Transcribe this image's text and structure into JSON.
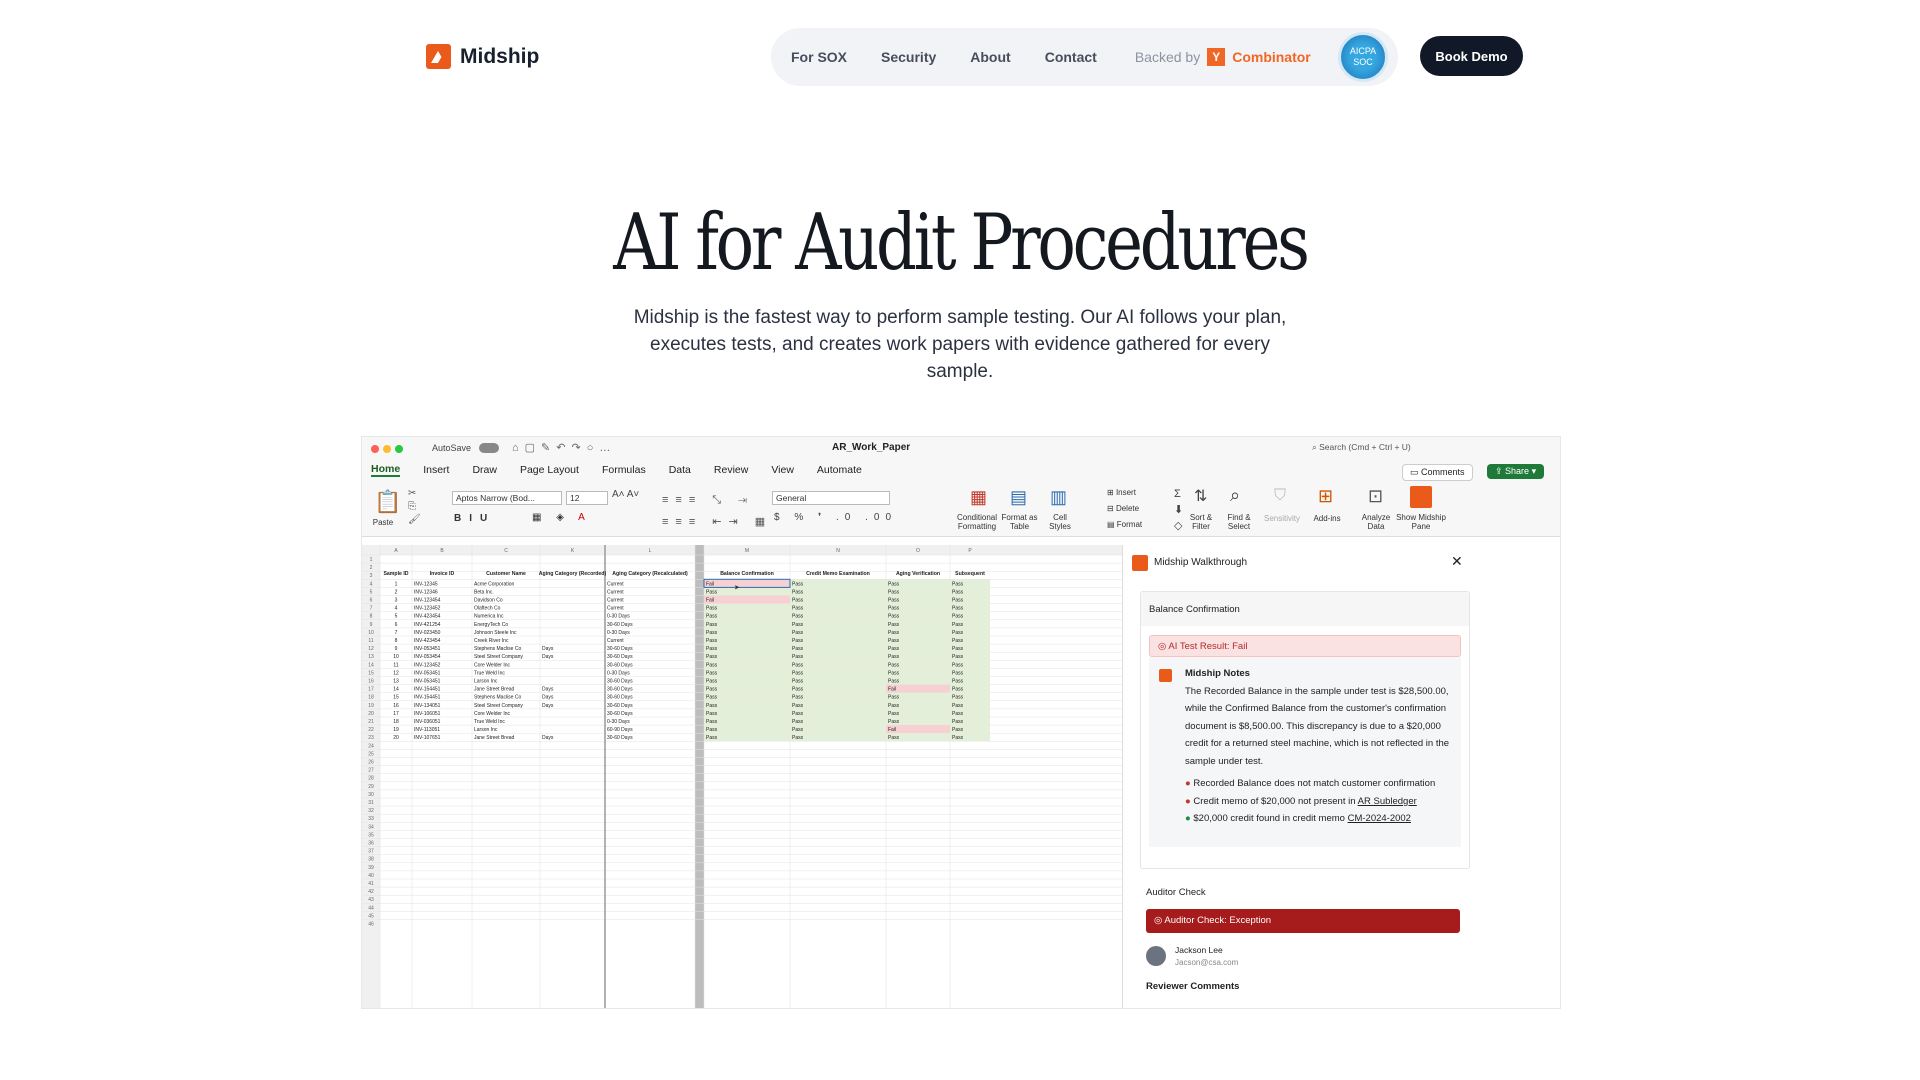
{
  "brand": {
    "name": "Midship"
  },
  "nav": {
    "items": [
      "For SOX",
      "Security",
      "About",
      "Contact"
    ],
    "backed_by": "Backed by",
    "yc_letter": "Y",
    "yc_name": "Combinator",
    "aicpa_line1": "AICPA",
    "aicpa_line2": "SOC",
    "cta": "Book Demo"
  },
  "hero": {
    "title": "AI for Audit Procedures",
    "subtitle_line1": "Midship is the fastest way to perform sample testing. Our AI follows your plan,",
    "subtitle_line2": "executes tests, and creates work papers with evidence gathered for every sample."
  },
  "excel": {
    "autosave": "AutoSave",
    "file_title": "AR_Work_Paper",
    "search_placeholder": "Search (Cmd + Ctrl + U)",
    "tabs": [
      "Home",
      "Insert",
      "Draw",
      "Page Layout",
      "Formulas",
      "Data",
      "Review",
      "View",
      "Automate"
    ],
    "comments": "Comments",
    "share": "Share",
    "font": "Aptos Narrow (Bod...",
    "font_size": "12",
    "number_format": "General",
    "ribbon_labels": {
      "paste": "Paste",
      "cond_format": "Conditional Formatting",
      "format_table": "Format as Table",
      "cell_styles": "Cell Styles",
      "insert": "Insert",
      "delete": "Delete",
      "format": "Format",
      "sort_filter": "Sort & Filter",
      "find_select": "Find & Select",
      "sensitivity": "Sensitivity",
      "addins": "Add-ins",
      "analyze": "Analyze Data",
      "show_midship": "Show Midship Pane"
    },
    "col_letters": [
      "A",
      "B",
      "C",
      "K",
      "L",
      "M",
      "N",
      "O",
      "P"
    ],
    "headers": [
      "Sample ID",
      "Invoice ID",
      "Customer Name",
      "Aging Category (Recorded)",
      "Aging Category (Recalculated)",
      "Balance Confirmation",
      "Credit Memo Examination",
      "Aging Verification",
      "Subsequent"
    ],
    "rows": [
      [
        "1",
        "INV-12345",
        "Acme Corporation",
        "",
        "Current",
        "Fail",
        "Pass",
        "Pass",
        "Pass"
      ],
      [
        "2",
        "INV-12346",
        "Beta Inc.",
        "",
        "Current",
        "Pass",
        "Pass",
        "Pass",
        "Pass"
      ],
      [
        "3",
        "INV-123454",
        "Davidson Co",
        "",
        "Current",
        "Fail",
        "Pass",
        "Pass",
        "Pass"
      ],
      [
        "4",
        "INV-123452",
        "Olaftech Co",
        "",
        "Current",
        "Pass",
        "Pass",
        "Pass",
        "Pass"
      ],
      [
        "5",
        "INV-423454",
        "Numerica Inc",
        "",
        "0-30 Days",
        "Pass",
        "Pass",
        "Pass",
        "Pass"
      ],
      [
        "6",
        "INV-421254",
        "EnergyTech Co",
        "",
        "30-60 Days",
        "Pass",
        "Pass",
        "Pass",
        "Pass"
      ],
      [
        "7",
        "INV-023450",
        "Johnson Steele Inc",
        "",
        "0-30 Days",
        "Pass",
        "Pass",
        "Pass",
        "Pass"
      ],
      [
        "8",
        "INV-423454",
        "Creek River Inc",
        "",
        "Current",
        "Pass",
        "Pass",
        "Pass",
        "Pass"
      ],
      [
        "9",
        "INV-053451",
        "Stephens Maclise Co",
        "Days",
        "30-60 Days",
        "Pass",
        "Pass",
        "Pass",
        "Pass"
      ],
      [
        "10",
        "INV-053454",
        "Steel Street Company",
        "Days",
        "30-60 Days",
        "Pass",
        "Pass",
        "Pass",
        "Pass"
      ],
      [
        "11",
        "INV-123452",
        "Core Welder Inc",
        "",
        "30-60 Days",
        "Pass",
        "Pass",
        "Pass",
        "Pass"
      ],
      [
        "12",
        "INV-053451",
        "True Weld Inc",
        "",
        "0-30 Days",
        "Pass",
        "Pass",
        "Pass",
        "Pass"
      ],
      [
        "13",
        "INV-053451",
        "Larson Inc",
        "",
        "30-60 Days",
        "Pass",
        "Pass",
        "Pass",
        "Pass"
      ],
      [
        "14",
        "INV-154451",
        "Jane Street Bread",
        "Days",
        "30-60 Days",
        "Pass",
        "Pass",
        "Fail",
        "Pass"
      ],
      [
        "15",
        "INV-154451",
        "Stephens Maclise Co",
        "Days",
        "30-60 Days",
        "Pass",
        "Pass",
        "Pass",
        "Pass"
      ],
      [
        "16",
        "INV-134051",
        "Steel Street Company",
        "Days",
        "30-60 Days",
        "Pass",
        "Pass",
        "Pass",
        "Pass"
      ],
      [
        "17",
        "INV-106051",
        "Core Welder Inc",
        "",
        "30-60 Days",
        "Pass",
        "Pass",
        "Pass",
        "Pass"
      ],
      [
        "18",
        "INV-036051",
        "True Weld Inc",
        "",
        "0-30 Days",
        "Pass",
        "Pass",
        "Pass",
        "Pass"
      ],
      [
        "19",
        "INV-113051",
        "Larson Inc",
        "",
        "60-90 Days",
        "Pass",
        "Pass",
        "Fail",
        "Pass"
      ],
      [
        "20",
        "INV-107651",
        "Jane Street Bread",
        "Days",
        "30-60 Days",
        "Pass",
        "Pass",
        "Pass",
        "Pass"
      ]
    ]
  },
  "panel": {
    "title": "Midship Walkthrough",
    "section": "Balance Confirmation",
    "ai_result": "AI Test Result: Fail",
    "notes_title": "Midship Notes",
    "notes_text": "The Recorded Balance in the sample under test is $28,500.00, while the Confirmed Balance from the customer's confirmation document is $8,500.00. This discrepancy is due to a $20,000 credit for a returned steel machine, which is not reflected in the sample under test.",
    "bullet1": "Recorded Balance does not match customer confirmation",
    "bullet2_pre": "Credit memo of $20,000 not present in ",
    "bullet2_link": "AR Subledger",
    "bullet3_pre": "$20,000 credit found in credit memo ",
    "bullet3_link": "CM-2024-2002",
    "auditor_check": "Auditor Check",
    "auditor_result": "Auditor Check: Exception",
    "user_name": "Jackson Lee",
    "user_email": "Jacson@csa.com",
    "reviewer": "Reviewer Comments"
  },
  "colors": {
    "accent": "#ea5a1a",
    "fail_red": "#a61b1b",
    "pass_green": "#e3efd9",
    "fail_cell": "#f6d0d2"
  }
}
